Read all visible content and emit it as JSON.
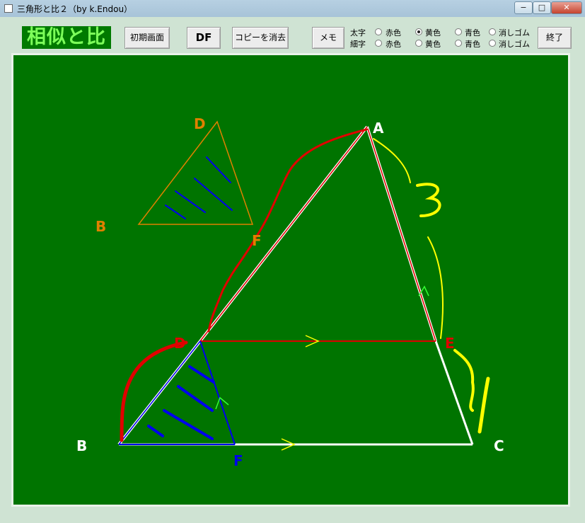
{
  "window": {
    "title": "三角形と比２（by k.Endou）",
    "controls": {
      "minimize": "−",
      "maximize": "□",
      "close": "✕"
    }
  },
  "toolbar": {
    "app_title": "相似と比",
    "buttons": {
      "reset": "初期画面",
      "df": "DF",
      "clear_copy": "コピーを消去",
      "memo": "メモ",
      "exit": "終了"
    },
    "rows": [
      {
        "label": "太字",
        "options": [
          "赤色",
          "黄色",
          "青色",
          "消しゴム"
        ],
        "selected": "黄色"
      },
      {
        "label": "細字",
        "options": [
          "赤色",
          "黄色",
          "青色",
          "消しゴム"
        ],
        "selected": ""
      }
    ]
  },
  "board": {
    "colors": {
      "board": "#007400",
      "white": "#ffffff",
      "red": "#e00000",
      "yellow": "#ffff00",
      "blue": "#0000ee",
      "orange": "#e08000"
    },
    "labels": {
      "A": "A",
      "B": "B",
      "C": "C",
      "D": "D",
      "E": "E",
      "F": "F",
      "copy_D": "D",
      "copy_B": "B",
      "copy_F": "F"
    },
    "handwriting": {
      "number_3": "3"
    }
  }
}
